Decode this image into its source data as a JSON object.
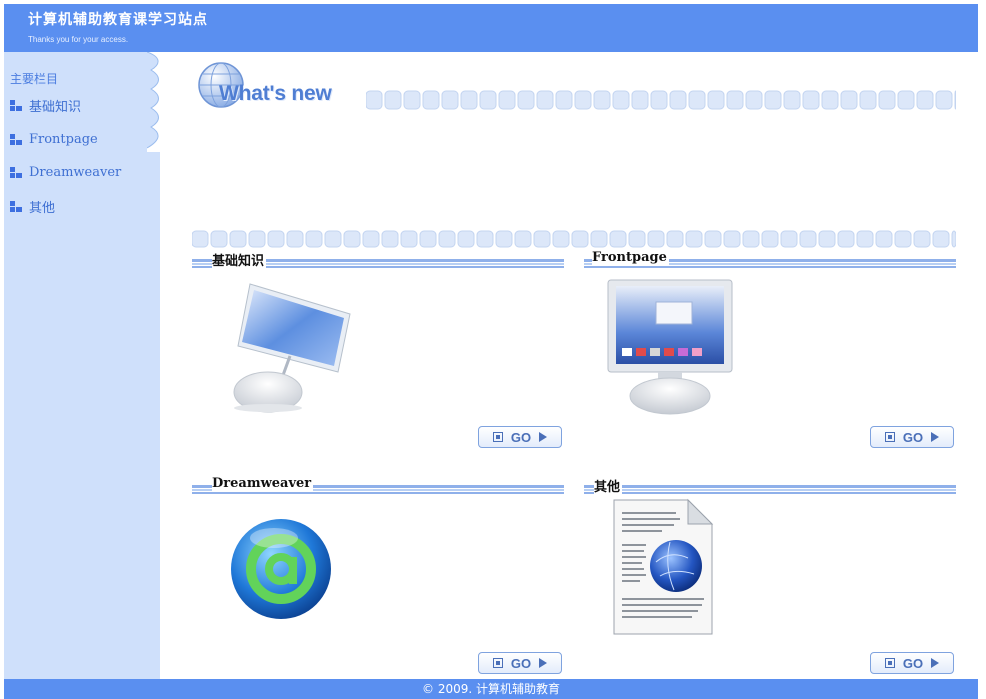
{
  "header": {
    "title": "计算机辅助教育课学习站点",
    "subtitle": "Thanks you for your access."
  },
  "sidebar": {
    "heading": "主要栏目",
    "items": [
      {
        "label": "基础知识"
      },
      {
        "label": "Frontpage"
      },
      {
        "label": "Dreamweaver"
      },
      {
        "label": "其他"
      }
    ]
  },
  "main": {
    "banner_title": "What's new",
    "sections": [
      {
        "title": "基础知识",
        "image": "imac-computer-icon",
        "button": "GO"
      },
      {
        "title": "Frontpage",
        "image": "flat-monitor-icon",
        "button": "GO"
      },
      {
        "title": "Dreamweaver",
        "image": "email-globe-icon",
        "button": "GO"
      },
      {
        "title": "其他",
        "image": "document-globe-icon",
        "button": "GO"
      }
    ]
  },
  "footer": {
    "copyright": "© 2009. 计算机辅助教育"
  },
  "colors": {
    "header_bg": "#5a8ff0",
    "sidebar_bg": "#cfe0fb",
    "accent": "#4f7ed3"
  }
}
